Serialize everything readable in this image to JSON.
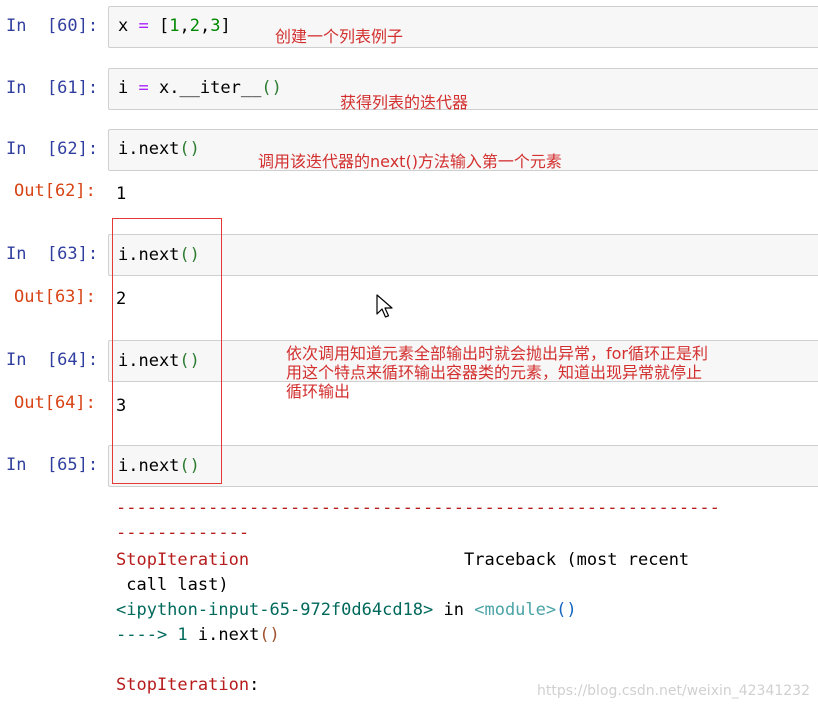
{
  "cells": [
    {
      "in_prompt": "In  [60]:",
      "code": {
        "a": "x ",
        "b": "=",
        "c": " [",
        "d": "1",
        "e": ",",
        "f": "2",
        "g": ",",
        "h": "3",
        "i": "]"
      }
    },
    {
      "in_prompt": "In  [61]:",
      "code": {
        "a": "i ",
        "b": "=",
        "c": " x.__iter__",
        "d": "()"
      }
    },
    {
      "in_prompt": "In  [62]:",
      "code": {
        "a": "i.next",
        "b": "()"
      },
      "out_prompt": "Out[62]:",
      "output": "1"
    },
    {
      "in_prompt": "In  [63]:",
      "code": {
        "a": "i.next",
        "b": "()"
      },
      "out_prompt": "Out[63]:",
      "output": "2"
    },
    {
      "in_prompt": "In  [64]:",
      "code": {
        "a": "i.next",
        "b": "()"
      },
      "out_prompt": "Out[64]:",
      "output": "3"
    },
    {
      "in_prompt": "In  [65]:",
      "code": {
        "a": "i.next",
        "b": "()"
      }
    }
  ],
  "annotations": {
    "note_60": "创建一个列表例子",
    "note_61": "获得列表的迭代器",
    "note_62": "调用该迭代器的next()方法输入第一个元素",
    "note_64_line1": "依次调用知道元素全部输出时就会抛出异常，for循环正是利",
    "note_64_line2": "用这个特点来循环输出容器类的元素，知道出现异常就停止",
    "note_64_line3": "循环输出"
  },
  "traceback": {
    "dash_line1": "-----------------------------------------------------------",
    "dash_line2": "-------------",
    "error_name": "StopIteration",
    "traceback_label": "                     Traceback (most recent",
    "call_last": " call last)",
    "input_ref": "<ipython-input-65-972f0d64cd18>",
    "in_word": " in ",
    "module": "<module>",
    "module_parens": "()",
    "arrow": "----> 1 ",
    "arrow_code": "i.next",
    "arrow_parens": "()",
    "final_error": "StopIteration",
    "final_colon": ":"
  },
  "watermark": "https://blog.csdn.net/weixin_42341232",
  "icons": {
    "cursor": "mouse-pointer-icon"
  }
}
